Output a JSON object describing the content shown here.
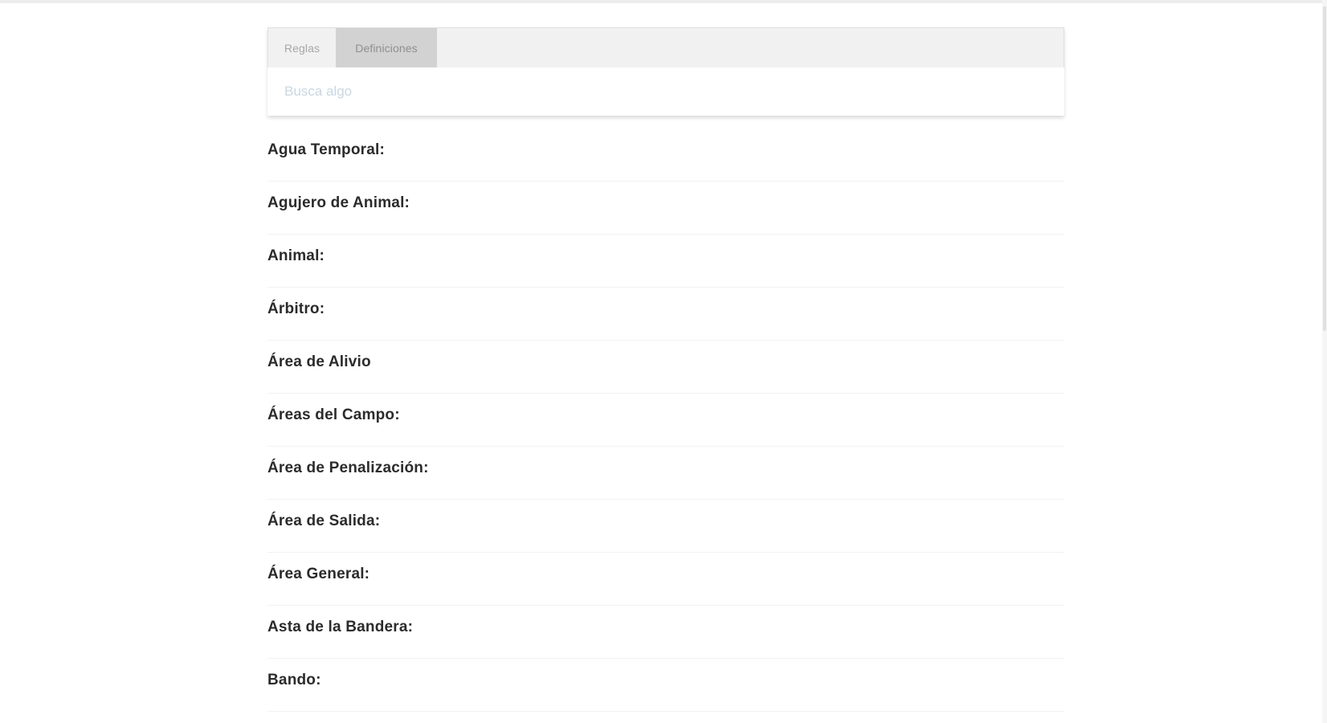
{
  "tabs": [
    {
      "label": "Reglas",
      "active": false
    },
    {
      "label": "Definiciones",
      "active": true
    }
  ],
  "search": {
    "placeholder": "Busca algo",
    "value": ""
  },
  "definitions": [
    "Agua Temporal:",
    "Agujero de Animal:",
    "Animal:",
    "Árbitro:",
    "Área de Alivio",
    "Áreas del Campo:",
    "Área de Penalización:",
    "Área de Salida:",
    "Área General:",
    "Asta de la Bandera:",
    "Bando:"
  ],
  "colors": {
    "active_tab_bg": "#d2d2d2",
    "tab_bar_bg": "#f1f1f1",
    "placeholder": "#c9d7e3",
    "term_text": "#2b2b2b"
  }
}
